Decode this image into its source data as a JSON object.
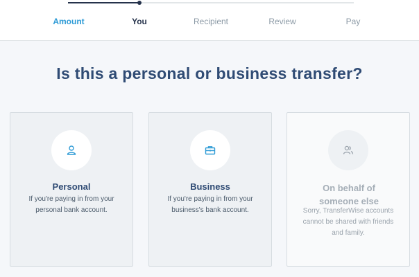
{
  "progress": {
    "steps": [
      "Amount",
      "You",
      "Recipient",
      "Review",
      "Pay"
    ],
    "current_index": 1,
    "fill_fraction": 0.25
  },
  "page": {
    "heading": "Is this a personal or business transfer?"
  },
  "options": [
    {
      "title": "Personal",
      "description": "If you're paying in from your personal bank account.",
      "icon": "person-icon",
      "enabled": true
    },
    {
      "title": "Business",
      "description": "If you're paying in from your business's bank account.",
      "icon": "briefcase-icon",
      "enabled": true
    },
    {
      "title": "On behalf of someone else",
      "description": "Sorry, TransferWise accounts cannot be shared with friends and family.",
      "icon": "people-icon",
      "enabled": false
    }
  ],
  "colors": {
    "accent": "#2e9bd6",
    "heading": "#2f4b74",
    "progress": "#25324b"
  }
}
